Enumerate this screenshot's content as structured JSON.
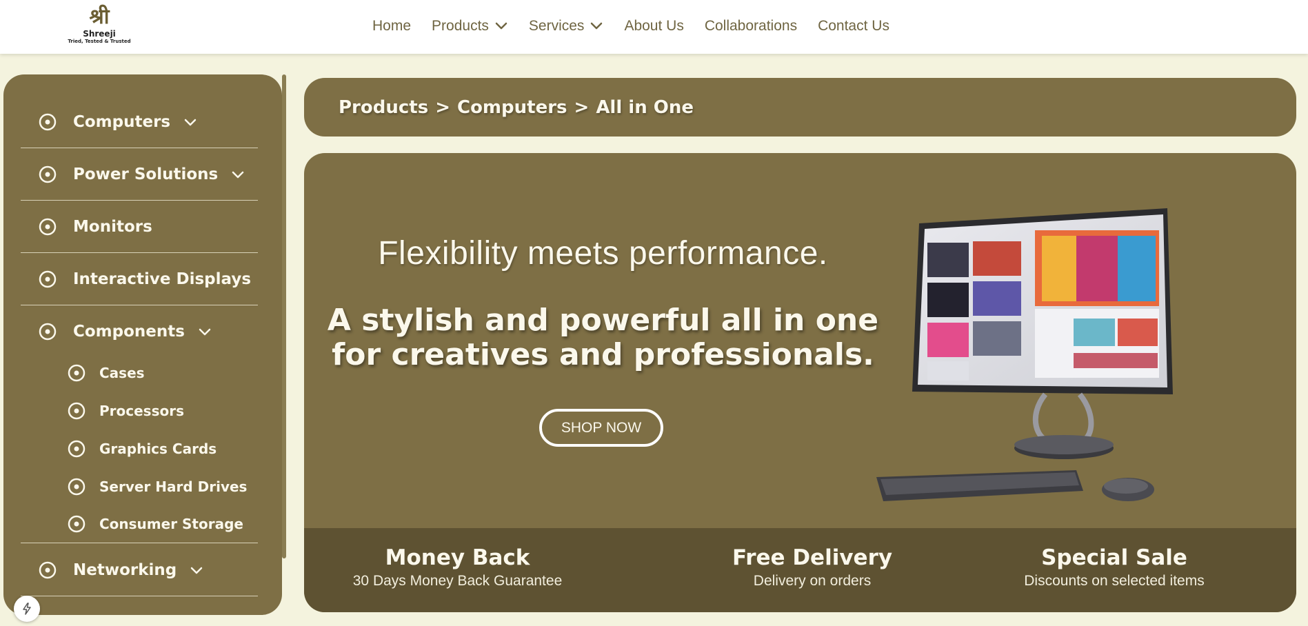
{
  "brand": {
    "logo_glyph": "श्री",
    "name": "Shreeji",
    "tagline": "Tried, Tested & Trusted"
  },
  "nav": {
    "items": [
      {
        "label": "Home",
        "dropdown": false
      },
      {
        "label": "Products",
        "dropdown": true
      },
      {
        "label": "Services",
        "dropdown": true
      },
      {
        "label": "About Us",
        "dropdown": false
      },
      {
        "label": "Collaborations",
        "dropdown": false
      },
      {
        "label": "Contact Us",
        "dropdown": false
      }
    ]
  },
  "sidebar": {
    "categories": [
      {
        "label": "Computers",
        "expandable": true
      },
      {
        "label": "Power Solutions",
        "expandable": true
      },
      {
        "label": "Monitors",
        "expandable": false
      },
      {
        "label": "Interactive Displays",
        "expandable": false
      },
      {
        "label": "Components",
        "expandable": true
      },
      {
        "label": "Networking",
        "expandable": true
      }
    ],
    "component_items": [
      "Cases",
      "Processors",
      "Graphics Cards",
      "Server Hard Drives",
      "Consumer Storage"
    ]
  },
  "breadcrumb": {
    "items": [
      "Products",
      "Computers",
      "All in One"
    ],
    "separator": ">"
  },
  "hero": {
    "tagline": "Flexibility meets performance.",
    "headline_line1": "A stylish and powerful all in one",
    "headline_line2": "for creatives and professionals.",
    "cta": "SHOP NOW"
  },
  "features": [
    {
      "title": "Money Back",
      "subtitle": "30 Days Money Back Guarantee"
    },
    {
      "title": "Free Delivery",
      "subtitle": "Delivery on orders"
    },
    {
      "title": "Special Sale",
      "subtitle": "Discounts on selected items"
    }
  ],
  "icons": {
    "radio": "radio-dot-icon",
    "chevron": "chevron-down-icon",
    "bolt": "lightning-icon"
  },
  "colors": {
    "panel": "#7e6f45",
    "panel_dark": "#5e5232",
    "page_bg": "#f4f3de",
    "text_light": "#fbf8ec",
    "nav_text": "#6f6542"
  }
}
